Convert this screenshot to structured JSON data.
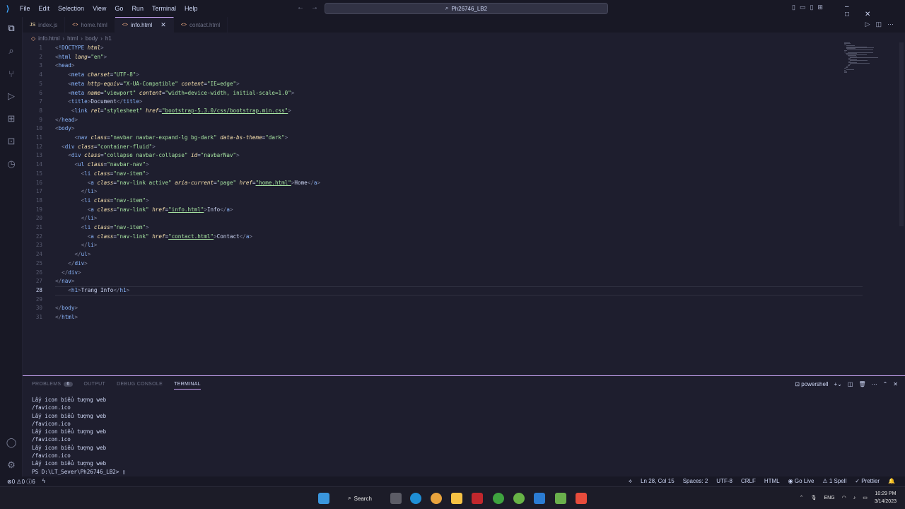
{
  "menu": [
    "File",
    "Edit",
    "Selection",
    "View",
    "Go",
    "Run",
    "Terminal",
    "Help"
  ],
  "search": {
    "text": "Ph26746_LB2"
  },
  "tabs": [
    {
      "label": "index.js",
      "icon": "JS",
      "active": false
    },
    {
      "label": "home.html",
      "icon": "<>",
      "active": false
    },
    {
      "label": "info.html",
      "icon": "<>",
      "active": true
    },
    {
      "label": "contact.html",
      "icon": "<>",
      "active": false
    }
  ],
  "breadcrumb": [
    "info.html",
    "html",
    "body",
    "h1"
  ],
  "editor": {
    "lines": [
      "<!DOCTYPE html>",
      "<html lang=\"en\">",
      "<head>",
      "    <meta charset=\"UTF-8\">",
      "    <meta http-equiv=\"X-UA-Compatible\" content=\"IE=edge\">",
      "    <meta name=\"viewport\" content=\"width=device-width, initial-scale=1.0\">",
      "    <title>Document</title>",
      "     <link rel=\"stylesheet\" href=\"bootstrap-5.3.0/css/bootstrap.min.css\">",
      "</head>",
      "<body>",
      "      <nav class=\"navbar navbar-expand-lg bg-dark\" data-bs-theme=\"dark\">",
      "  <div class=\"container-fluid\">",
      "    <div class=\"collapse navbar-collapse\" id=\"navbarNav\">",
      "      <ul class=\"navbar-nav\">",
      "        <li class=\"nav-item\">",
      "          <a class=\"nav-link active\" aria-current=\"page\" href=\"home.html\">Home</a>",
      "        </li>",
      "        <li class=\"nav-item\">",
      "          <a class=\"nav-link\" href=\"info.html\">Info</a>",
      "        </li>",
      "        <li class=\"nav-item\">",
      "          <a class=\"nav-link\" href=\"contact.html\">Contact</a>",
      "        </li>",
      "      </ul>",
      "    </div>",
      "  </div>",
      "</nav>",
      "    <h1>Trang Info</h1>",
      "",
      "</body>",
      "</html>"
    ],
    "current_line": 28
  },
  "panel": {
    "tabs": [
      {
        "label": "PROBLEMS",
        "badge": "6"
      },
      {
        "label": "OUTPUT"
      },
      {
        "label": "DEBUG CONSOLE"
      },
      {
        "label": "TERMINAL",
        "active": true
      }
    ],
    "shell": "powershell"
  },
  "terminal": {
    "lines": [
      "Lấy icon biểu tượng web",
      "/favicon.ico",
      "Lấy icon biểu tượng web",
      "/favicon.ico",
      "Lấy icon biểu tượng web",
      "/favicon.ico",
      "Lấy icon biểu tượng web",
      "/favicon.ico",
      "Lấy icon biểu tượng web",
      "PS D:\\LT_Sever\\Ph26746_LB2> "
    ]
  },
  "status": {
    "errors": "0",
    "warnings": "0",
    "info": "6",
    "position": "Ln 28, Col 15",
    "spaces": "Spaces: 2",
    "encoding": "UTF-8",
    "eol": "CRLF",
    "language": "HTML",
    "golive": "Go Live",
    "spell": "1 Spell",
    "prettier": "Prettier"
  },
  "taskbar": {
    "search_label": "Search",
    "lang": "ENG",
    "time": "10:29 PM",
    "date": "3/14/2023"
  },
  "colors": {
    "accent": "#cba6f7",
    "tag": "#89b4fa",
    "attr": "#f9e2af",
    "string": "#a6e3a1"
  }
}
